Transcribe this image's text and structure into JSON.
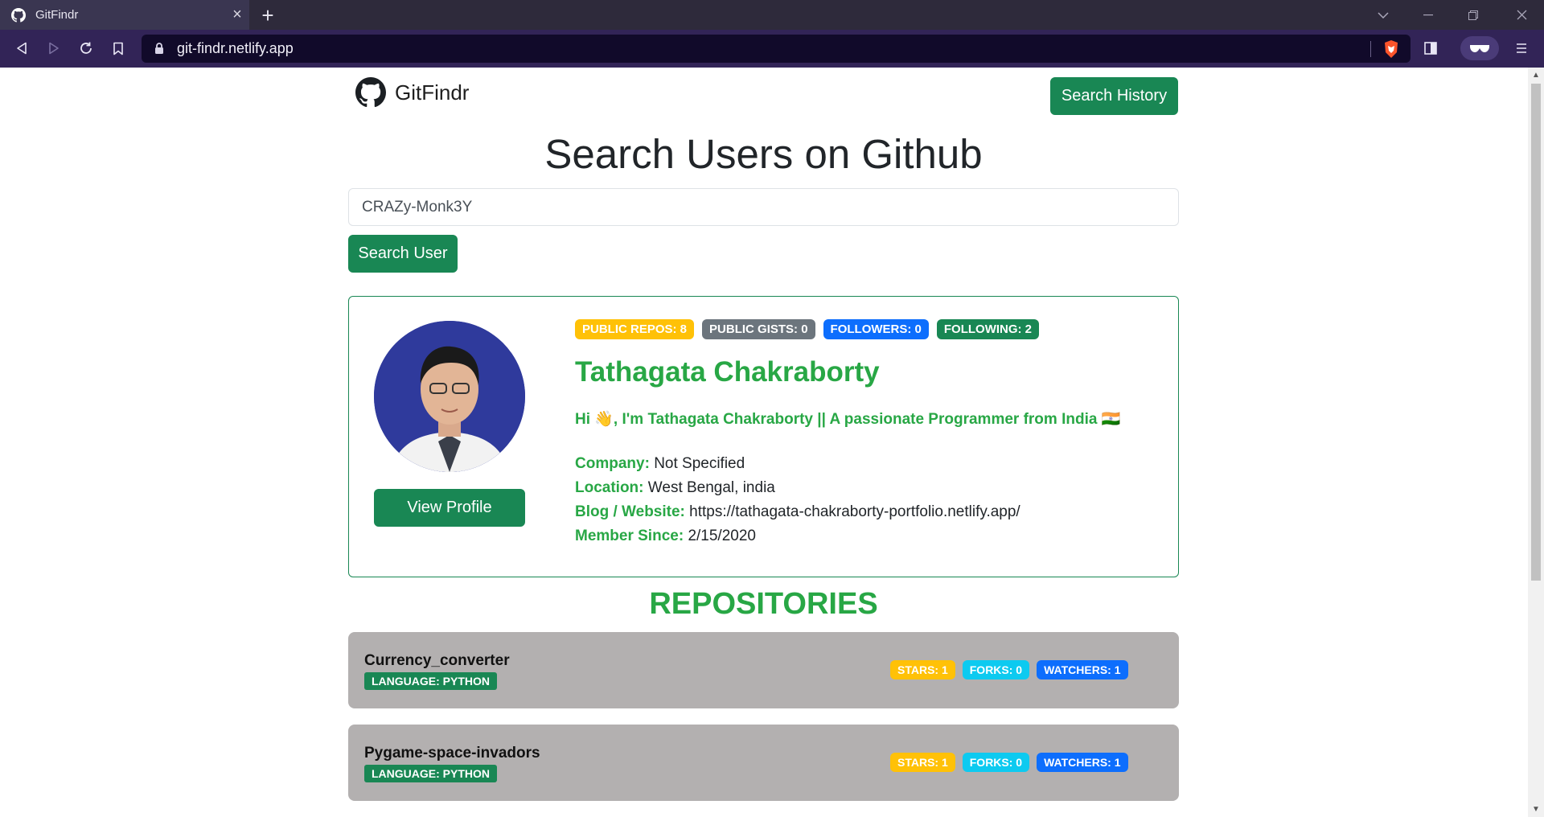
{
  "browser": {
    "tab_title": "GitFindr",
    "url": "git-findr.netlify.app"
  },
  "app": {
    "brand": "GitFindr",
    "history_button": "Search History",
    "page_title": "Search Users on Github",
    "search_value": "CRAZy-Monk3Y",
    "search_button": "Search User"
  },
  "profile": {
    "badges": {
      "public_repos": "PUBLIC REPOS: 8",
      "public_gists": "PUBLIC GISTS: 0",
      "followers": "FOLLOWERS: 0",
      "following": "FOLLOWING: 2"
    },
    "name": "Tathagata Chakraborty",
    "bio": "Hi 👋, I'm Tathagata Chakraborty || A passionate Programmer from India 🇮🇳",
    "company_label": "Company:",
    "company": "Not Specified",
    "location_label": "Location:",
    "location": "West Bengal, india",
    "blog_label": "Blog / Website:",
    "blog": "https://tathagata-chakraborty-portfolio.netlify.app/",
    "member_label": "Member Since:",
    "member_since": "2/15/2020",
    "view_profile": "View Profile"
  },
  "repos_title": "REPOSITORIES",
  "repos": [
    {
      "name": "Currency_converter",
      "language": "LANGUAGE: PYTHON",
      "stars": "STARS: 1",
      "forks": "FORKS: 0",
      "watchers": "WATCHERS: 1"
    },
    {
      "name": "Pygame-space-invadors",
      "language": "LANGUAGE: PYTHON",
      "stars": "STARS: 1",
      "forks": "FORKS: 0",
      "watchers": "WATCHERS: 1"
    }
  ],
  "colors": {
    "accent_green": "#198754",
    "text_green": "#28a745",
    "repo_card_bg": "#b3b0b0",
    "browser_toolbar": "#322457"
  }
}
